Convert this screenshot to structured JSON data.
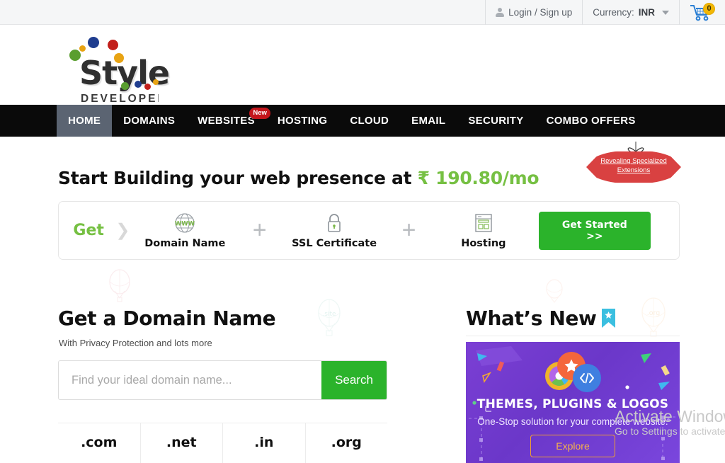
{
  "topbar": {
    "login": "Login / Sign up",
    "currency_label": "Currency:",
    "currency_value": "INR",
    "cart_count": "0",
    "user_icon": "user-icon",
    "caret_icon": "chevron-down-icon",
    "cart_icon": "shopping-cart-icon"
  },
  "logo": {
    "name": "Style",
    "sub": "DEVELOPERS"
  },
  "nav": {
    "items": [
      {
        "label": "HOME",
        "active": true,
        "badge": ""
      },
      {
        "label": "DOMAINS",
        "active": false,
        "badge": ""
      },
      {
        "label": "WEBSITES",
        "active": false,
        "badge": "New"
      },
      {
        "label": "HOSTING",
        "active": false,
        "badge": ""
      },
      {
        "label": "CLOUD",
        "active": false,
        "badge": ""
      },
      {
        "label": "EMAIL",
        "active": false,
        "badge": ""
      },
      {
        "label": "SECURITY",
        "active": false,
        "badge": ""
      },
      {
        "label": "COMBO OFFERS",
        "active": false,
        "badge": ""
      }
    ]
  },
  "hero": {
    "title_prefix": "Start Building your web presence at ",
    "price": "₹ 190.80/mo",
    "tag_line1": "Revealing Specialized",
    "tag_line2": "Extensions"
  },
  "bundle": {
    "get_label": "Get",
    "items": [
      {
        "label": "Domain Name",
        "icon": "globe-www-icon"
      },
      {
        "label": "SSL Certificate",
        "icon": "lock-icon"
      },
      {
        "label": "Hosting",
        "icon": "server-window-icon"
      }
    ],
    "plus": "+",
    "cta": "Get Started >>"
  },
  "domain_section": {
    "title": "Get a Domain Name",
    "subtitle": "With Privacy Protection and lots more",
    "search_placeholder": "Find your ideal domain name...",
    "search_value": "",
    "search_button": "Search",
    "tlds": [
      ".com",
      ".net",
      ".in",
      ".org"
    ]
  },
  "whats_new": {
    "title": "What’s New",
    "icon": "bookmark-star-icon",
    "promo_title": "THEMES, PLUGINS & LOGOS",
    "promo_sub": "One-Stop solution for your complete website.",
    "promo_button": "Explore"
  },
  "watermark": {
    "line1": "Activate Windows",
    "line2": "Go to Settings to activate"
  },
  "decor": {
    "balloon_site": ".site",
    "balloon_org": ".org"
  },
  "colors": {
    "accent_green": "#76c043",
    "button_green": "#2bb32b",
    "nav_black": "#0a0a0a",
    "nav_active": "#5b6472",
    "promo_purple": "#7b3fd4",
    "badge_red": "#c4161c",
    "tag_red": "#d94141",
    "cart_badge": "#f2b705",
    "explore_orange": "#f0a030"
  }
}
